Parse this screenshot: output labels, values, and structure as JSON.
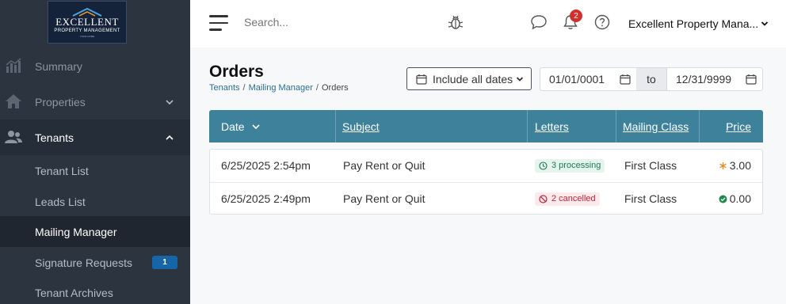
{
  "logo": {
    "main": "EXCELLENT",
    "sub": "PROPERTY MANAGEMENT",
    "tagline": "YOUR HOME"
  },
  "sidebar": {
    "items": [
      {
        "label": "Summary",
        "icon": "chart-icon"
      },
      {
        "label": "Properties",
        "icon": "home-icon"
      },
      {
        "label": "Tenants",
        "icon": "users-icon"
      }
    ],
    "sub_items": [
      {
        "label": "Tenant List"
      },
      {
        "label": "Leads List"
      },
      {
        "label": "Mailing Manager"
      },
      {
        "label": "Signature Requests",
        "badge": "1"
      },
      {
        "label": "Tenant Archives"
      }
    ]
  },
  "header": {
    "search_placeholder": "Search...",
    "notification_count": "2",
    "account_name": "Excellent Property Mana..."
  },
  "page": {
    "title": "Orders",
    "breadcrumb": [
      "Tenants",
      "Mailing Manager",
      "Orders"
    ],
    "breadcrumb_sep": "/",
    "date_filter_label": "Include all dates",
    "date_from": "01/01/0001",
    "date_to_label": "to",
    "date_to": "12/31/9999"
  },
  "table": {
    "columns": [
      "Date",
      "Subject",
      "Letters",
      "Mailing Class",
      "Price"
    ],
    "rows": [
      {
        "date": "6/25/2025 2:54pm",
        "subject": "Pay Rent or Quit",
        "letters": "3 processing",
        "letters_status": "processing",
        "mailing_class": "First Class",
        "price": "3.00",
        "price_status": "pending"
      },
      {
        "date": "6/25/2025 2:49pm",
        "subject": "Pay Rent or Quit",
        "letters": "2 cancelled",
        "letters_status": "cancelled",
        "mailing_class": "First Class",
        "price": "0.00",
        "price_status": "ok"
      }
    ]
  },
  "colors": {
    "sidebar_bg": "#2c3440",
    "table_header": "#3d819a",
    "badge_blue": "#1565a8",
    "notification_red": "#d32f2f",
    "processing_green": "#1d7a55",
    "cancelled_red": "#b8283a",
    "price_pending": "#e08a2b",
    "price_ok": "#1d8a4c"
  }
}
